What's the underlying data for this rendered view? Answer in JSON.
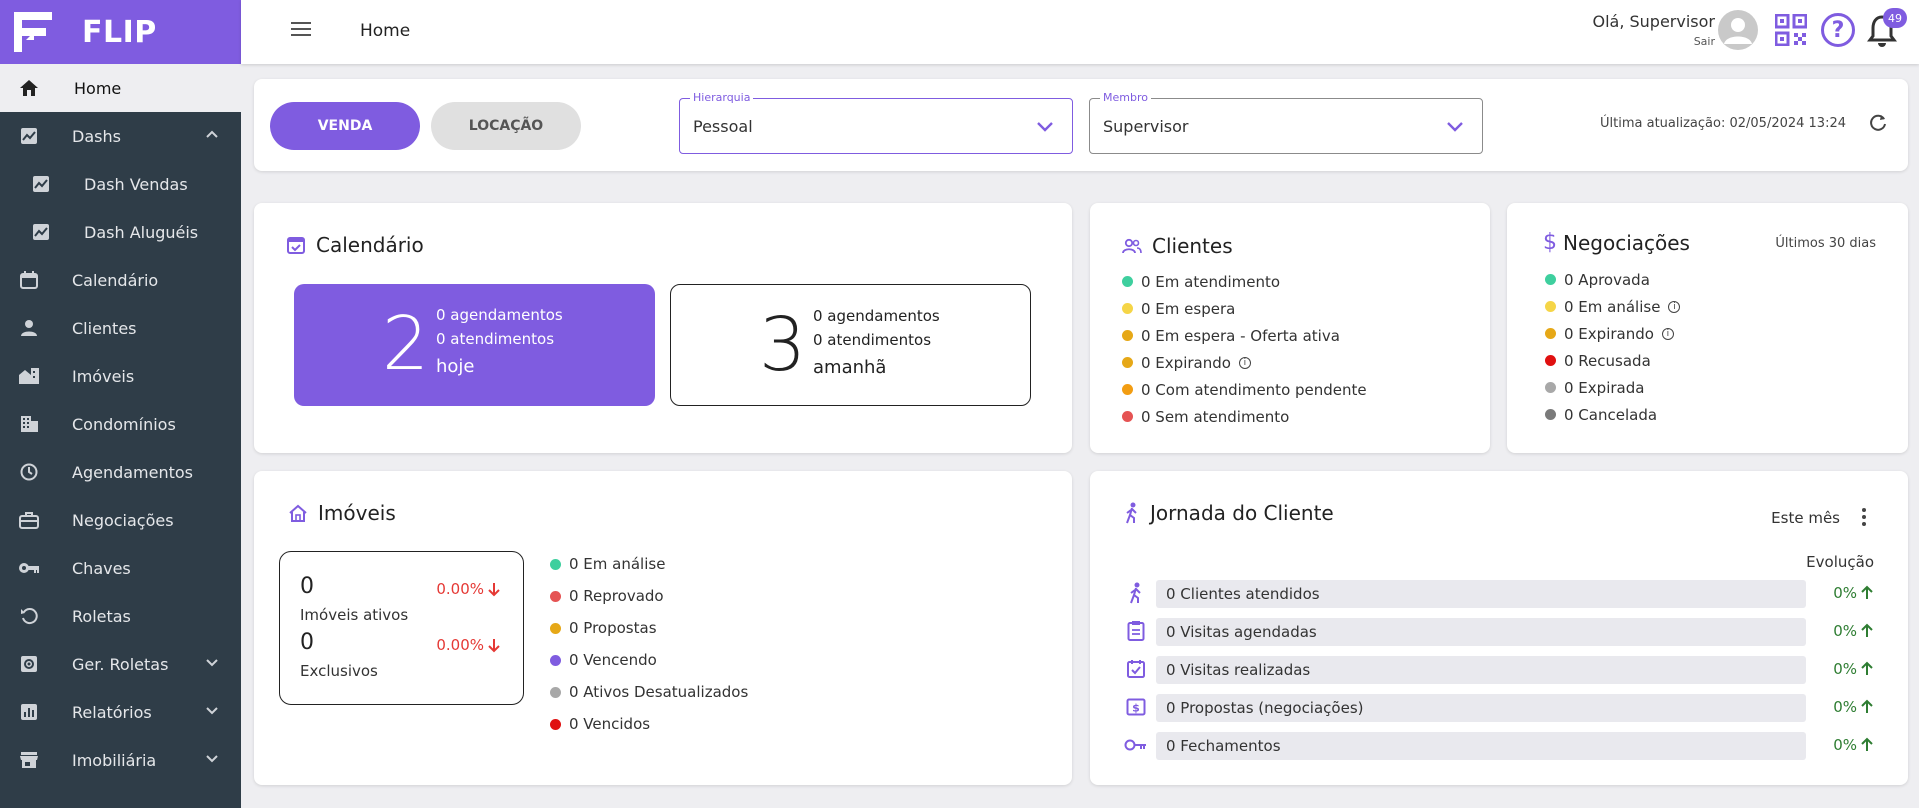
{
  "brand": {
    "name": "FLIP"
  },
  "sidebar": {
    "items": [
      {
        "label": "Home",
        "icon": "home-icon"
      },
      {
        "label": "Dashs",
        "icon": "chart-icon"
      },
      {
        "label": "Dash Vendas",
        "icon": "chart-box-icon"
      },
      {
        "label": "Dash Aluguéis",
        "icon": "chart-box-icon"
      },
      {
        "label": "Calendário",
        "icon": "calendar-icon"
      },
      {
        "label": "Clientes",
        "icon": "person-icon"
      },
      {
        "label": "Imóveis",
        "icon": "buildings-icon"
      },
      {
        "label": "Condomínios",
        "icon": "apartment-icon"
      },
      {
        "label": "Agendamentos",
        "icon": "clock-icon"
      },
      {
        "label": "Negociações",
        "icon": "briefcase-icon"
      },
      {
        "label": "Chaves",
        "icon": "key-icon"
      },
      {
        "label": "Roletas",
        "icon": "rotate-icon"
      },
      {
        "label": "Ger. Roletas",
        "icon": "gear-box-icon"
      },
      {
        "label": "Relatórios",
        "icon": "report-icon"
      },
      {
        "label": "Imobiliária",
        "icon": "store-icon"
      }
    ]
  },
  "topbar": {
    "title": "Home",
    "greeting": "Olá, Supervisor",
    "logout": "Sair",
    "notifications": "49"
  },
  "filters": {
    "venda": "VENDA",
    "locacao": "LOCAÇÃO",
    "hierarquia": {
      "label": "Hierarquia",
      "value": "Pessoal"
    },
    "membro": {
      "label": "Membro",
      "value": "Supervisor"
    },
    "updated": "Última atualização: 02/05/2024 13:24"
  },
  "calendar": {
    "title": "Calendário",
    "today": {
      "count": "2",
      "line1": "0 agendamentos",
      "line2": "0 atendimentos",
      "line3": "hoje"
    },
    "tomorrow": {
      "count": "3",
      "line1": "0 agendamentos",
      "line2": "0 atendimentos",
      "line3": "amanhã"
    }
  },
  "clients": {
    "title": "Clientes",
    "items": [
      {
        "label": "0 Em atendimento",
        "color": "#3ecf9e"
      },
      {
        "label": "0 Em espera",
        "color": "#f5d547"
      },
      {
        "label": "0 Em espera - Oferta ativa",
        "color": "#e6a817"
      },
      {
        "label": "0 Expirando",
        "color": "#e6a817"
      },
      {
        "label": "0 Com atendimento pendente",
        "color": "#f29d12"
      },
      {
        "label": "0 Sem atendimento",
        "color": "#e55353"
      }
    ]
  },
  "negotiations": {
    "title": "Negociações",
    "period": "Últimos 30 dias",
    "items": [
      {
        "label": "0 Aprovada",
        "color": "#3ecf9e"
      },
      {
        "label": "0 Em análise",
        "color": "#f5d547"
      },
      {
        "label": "0 Expirando",
        "color": "#e6a817"
      },
      {
        "label": "0 Recusada",
        "color": "#e01010"
      },
      {
        "label": "0 Expirada",
        "color": "#a8a8a8"
      },
      {
        "label": "0 Cancelada",
        "color": "#7a7a7a"
      }
    ]
  },
  "properties": {
    "title": "Imóveis",
    "ativos": {
      "value": "0",
      "label": "Imóveis ativos",
      "pct": "0.00%"
    },
    "exclusivos": {
      "value": "0",
      "label": "Exclusivos",
      "pct": "0.00%"
    },
    "items": [
      {
        "label": "0 Em análise",
        "color": "#3ecf9e"
      },
      {
        "label": "0 Reprovado",
        "color": "#e55353"
      },
      {
        "label": "0 Propostas",
        "color": "#e6a817"
      },
      {
        "label": "0 Vencendo",
        "color": "#7f5ce0"
      },
      {
        "label": "0 Ativos Desatualizados",
        "color": "#a8a8a8"
      },
      {
        "label": "0 Vencidos",
        "color": "#e01010"
      }
    ]
  },
  "journey": {
    "title": "Jornada do Cliente",
    "period": "Este mês",
    "evolution": "Evolução",
    "rows": [
      {
        "label": "0 Clientes atendidos",
        "pct": "0%",
        "icon": "walk-icon"
      },
      {
        "label": "0 Visitas agendadas",
        "pct": "0%",
        "icon": "clipboard-icon"
      },
      {
        "label": "0 Visitas realizadas",
        "pct": "0%",
        "icon": "calendar-check-icon"
      },
      {
        "label": "0 Propostas (negociações)",
        "pct": "0%",
        "icon": "money-icon"
      },
      {
        "label": "0 Fechamentos",
        "pct": "0%",
        "icon": "key-icon"
      }
    ]
  },
  "colors": {
    "accent": "#7f5ce0",
    "sidebar": "#2f3d48",
    "positive": "#2e7d32",
    "negative": "#e53935"
  }
}
